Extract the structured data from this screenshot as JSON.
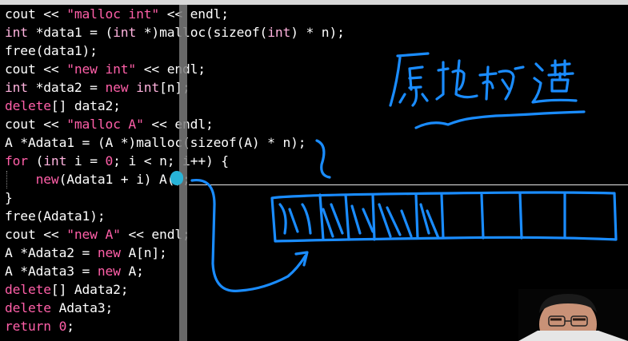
{
  "code": {
    "lines": [
      [
        {
          "t": "cout << ",
          "c": ""
        },
        {
          "t": "\"malloc int\"",
          "c": "str"
        },
        {
          "t": " << endl;",
          "c": ""
        }
      ],
      [
        {
          "t": "int",
          "c": "ty"
        },
        {
          "t": " *data1 = (",
          "c": ""
        },
        {
          "t": "int",
          "c": "ty"
        },
        {
          "t": " *)malloc(sizeof(",
          "c": ""
        },
        {
          "t": "int",
          "c": "ty"
        },
        {
          "t": ") * n);",
          "c": ""
        }
      ],
      [
        {
          "t": "free(data1);",
          "c": ""
        }
      ],
      [
        {
          "t": "cout << ",
          "c": ""
        },
        {
          "t": "\"new int\"",
          "c": "str"
        },
        {
          "t": " << endl;",
          "c": ""
        }
      ],
      [
        {
          "t": "int",
          "c": "ty"
        },
        {
          "t": " *data2 = ",
          "c": ""
        },
        {
          "t": "new",
          "c": "kw"
        },
        {
          "t": " ",
          "c": ""
        },
        {
          "t": "int",
          "c": "ty"
        },
        {
          "t": "[n];",
          "c": ""
        }
      ],
      [
        {
          "t": "delete",
          "c": "kw"
        },
        {
          "t": "[] data2;",
          "c": ""
        }
      ],
      [
        {
          "t": "cout << ",
          "c": ""
        },
        {
          "t": "\"malloc A\"",
          "c": "str"
        },
        {
          "t": " << endl;",
          "c": ""
        }
      ],
      [
        {
          "t": "A *Adata1 = (A *)malloc(sizeof(A) * n);",
          "c": ""
        }
      ],
      [
        {
          "t": "for",
          "c": "kw"
        },
        {
          "t": " (",
          "c": ""
        },
        {
          "t": "int",
          "c": "ty"
        },
        {
          "t": " i = ",
          "c": ""
        },
        {
          "t": "0",
          "c": "num"
        },
        {
          "t": "; i < n; i++) {",
          "c": ""
        }
      ],
      [
        {
          "t": "    ",
          "c": ""
        },
        {
          "t": "new",
          "c": "kw"
        },
        {
          "t": "(Adata1 + i) A",
          "c": ""
        },
        {
          "t": "()",
          "c": "cur"
        },
        {
          "t": ";",
          "c": ""
        }
      ],
      [
        {
          "t": "}",
          "c": ""
        }
      ],
      [
        {
          "t": "free(Adata1);",
          "c": ""
        }
      ],
      [
        {
          "t": "cout << ",
          "c": ""
        },
        {
          "t": "\"new A\"",
          "c": "str"
        },
        {
          "t": " << endl;",
          "c": ""
        }
      ],
      [
        {
          "t": "A *Adata2 = ",
          "c": ""
        },
        {
          "t": "new",
          "c": "kw"
        },
        {
          "t": " A[n];",
          "c": ""
        }
      ],
      [
        {
          "t": "A *Adata3 = ",
          "c": ""
        },
        {
          "t": "new",
          "c": "kw"
        },
        {
          "t": " A;",
          "c": ""
        }
      ],
      [
        {
          "t": "delete",
          "c": "kw"
        },
        {
          "t": "[] Adata2;",
          "c": ""
        }
      ],
      [
        {
          "t": "delete",
          "c": "kw"
        },
        {
          "t": " Adata3;",
          "c": ""
        }
      ],
      [
        {
          "t": "return",
          "c": "kw"
        },
        {
          "t": " ",
          "c": ""
        },
        {
          "t": "0",
          "c": "num"
        },
        {
          "t": ";",
          "c": ""
        }
      ]
    ]
  },
  "annotation": {
    "handwriting": "原地构造",
    "ink_color": "#1a8cff"
  },
  "colors": {
    "background": "#000000",
    "keyword": "#ff5fa8",
    "text": "#ffffff",
    "cursor": "#28b4d8"
  }
}
